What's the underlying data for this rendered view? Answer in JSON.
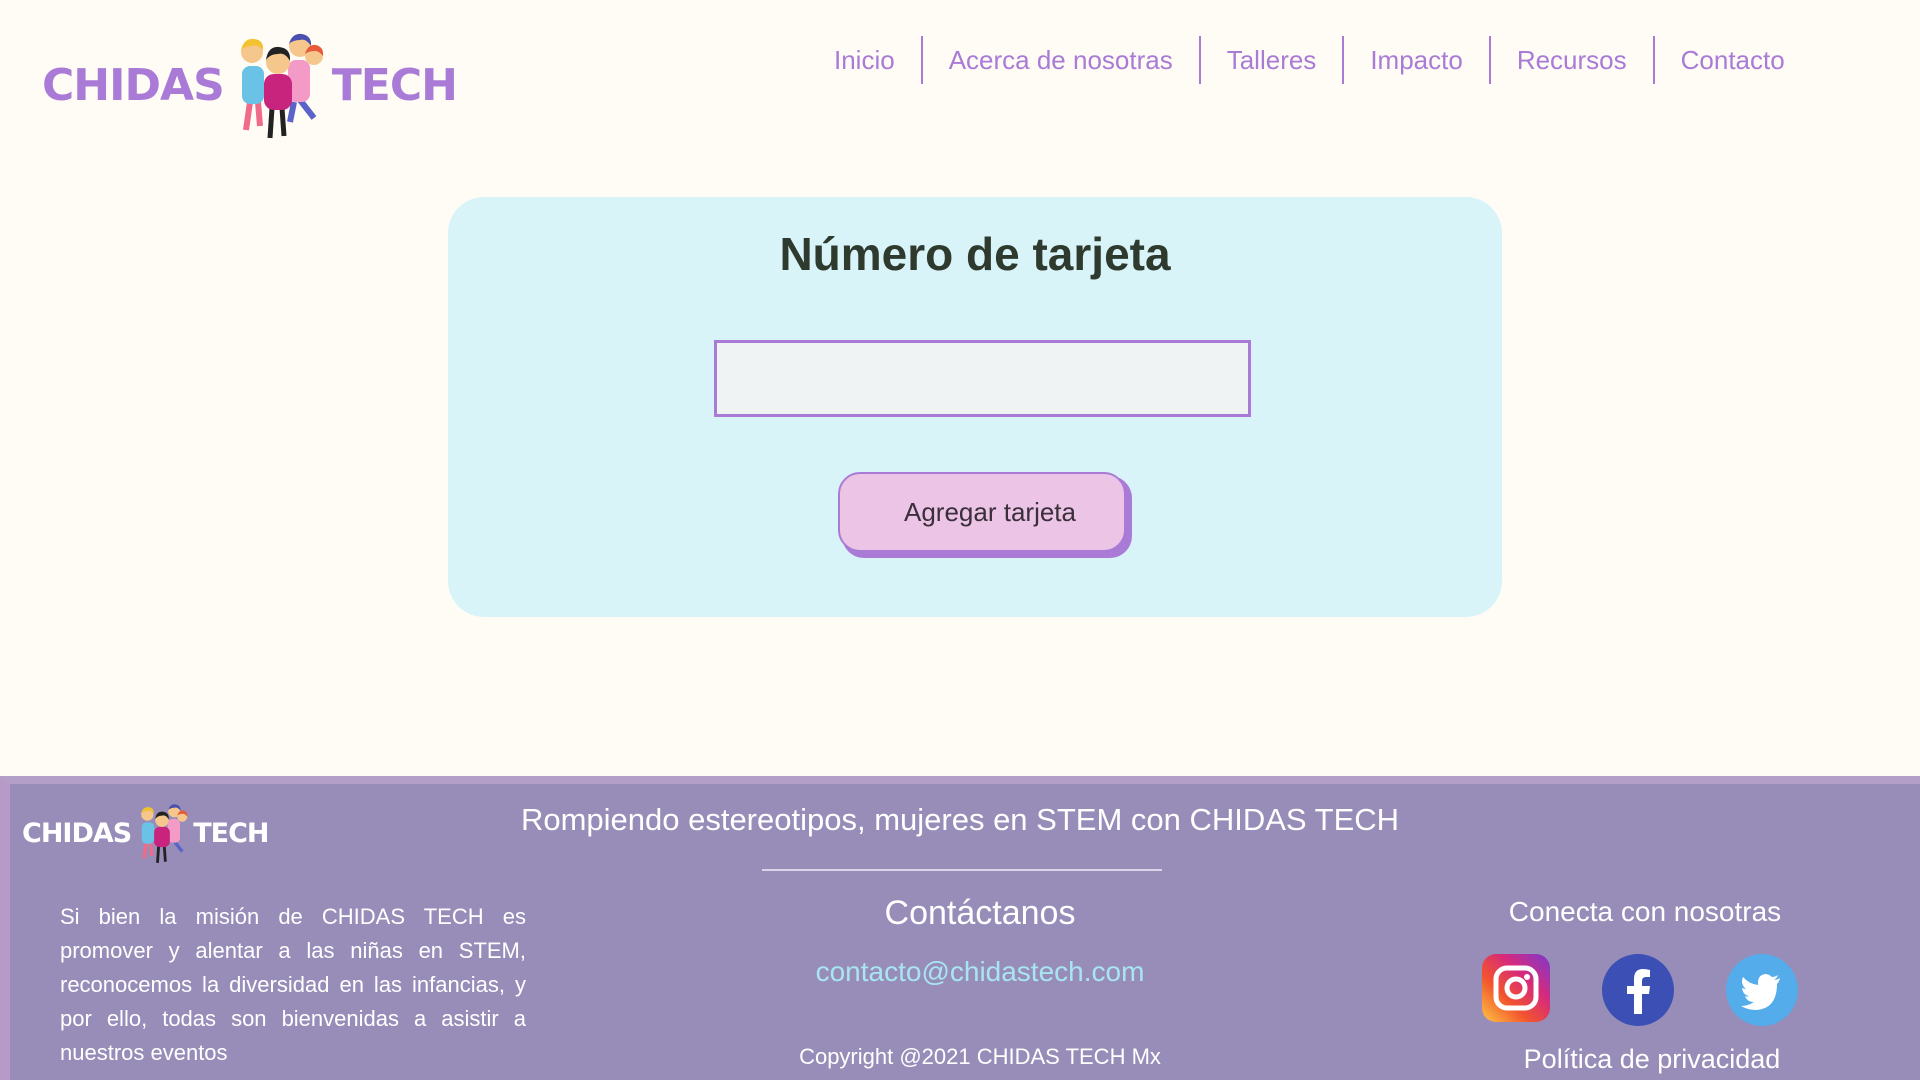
{
  "header": {
    "logo_left": "CHIDAS",
    "logo_right": "TECH",
    "nav": [
      "Inicio",
      "Acerca de nosotras",
      "Talleres",
      "Impacto",
      "Recursos",
      "Contacto"
    ]
  },
  "card": {
    "title": "Número de tarjeta",
    "input_value": "",
    "button_label": "Agregar tarjeta"
  },
  "footer": {
    "logo_left": "CHIDAS",
    "logo_right": "TECH",
    "tagline": "Rompiendo estereotipos, mujeres en STEM con CHIDAS TECH",
    "mission": "Si bien la misión de CHIDAS TECH es promover y alentar a las niñas en STEM, reconocemos la diversidad en las infancias, y por ello, todas son bienvenidas a asistir a nuestros eventos",
    "contact_title": "Contáctanos",
    "email": "contacto@chidastech.com",
    "copyright": "Copyright @2021 CHIDAS TECH Mx",
    "connect_title": "Conecta con nosotras",
    "socials": [
      "instagram-icon",
      "facebook-icon",
      "twitter-icon"
    ],
    "privacy": "Política de privacidad"
  },
  "colors": {
    "brand_purple": "#a97bd6",
    "card_bg": "#d9f4f8",
    "button_bg": "#ebc4e6",
    "footer_bg": "#978db8",
    "email_link": "#a9e5f0",
    "page_bg": "#fffcf5"
  }
}
